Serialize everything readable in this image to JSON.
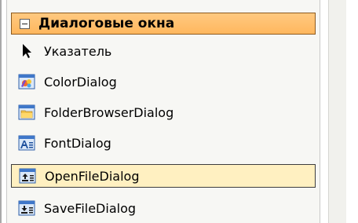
{
  "toolbox": {
    "category": {
      "label": "Диалоговые окна",
      "state": "expanded"
    },
    "items": [
      {
        "label": "Указатель",
        "icon": "pointer-icon"
      },
      {
        "label": "ColorDialog",
        "icon": "color-dialog-icon"
      },
      {
        "label": "FolderBrowserDialog",
        "icon": "folder-browser-icon"
      },
      {
        "label": "FontDialog",
        "icon": "font-dialog-icon"
      },
      {
        "label": "OpenFileDialog",
        "icon": "open-file-dialog-icon",
        "selected": true
      },
      {
        "label": "SaveFileDialog",
        "icon": "save-file-dialog-icon"
      }
    ]
  },
  "colors": {
    "header_fill": "#ffb75e",
    "header_border": "#8c5a1f",
    "selection_fill": "#fff0c1",
    "panel_background": "#f7f7f4"
  }
}
